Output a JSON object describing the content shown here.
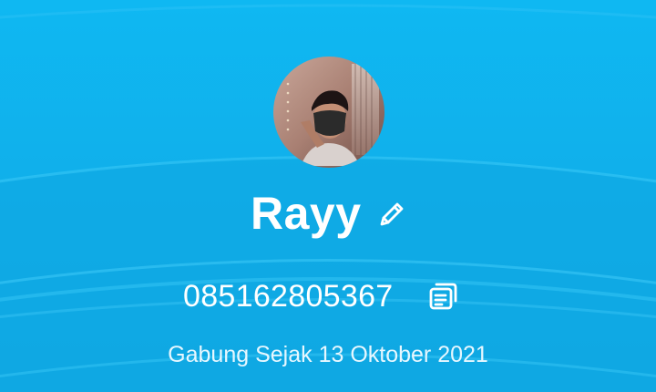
{
  "profile": {
    "name": "Rayy",
    "phone": "085162805367",
    "joined_text": "Gabung Sejak 13 Oktober 2021"
  },
  "icons": {
    "avatar": "profile-photo",
    "edit": "pencil-icon",
    "copy": "copy-icon"
  },
  "colors": {
    "background": "#10aee9",
    "text": "#ffffff"
  }
}
